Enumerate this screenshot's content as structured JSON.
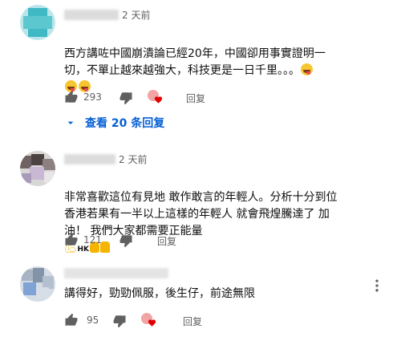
{
  "comments": [
    {
      "time": "2 天前",
      "text": "西方講咗中國崩潰論已經20年，中國卻用事實證明一\n切，不單止越來越強大，科技更是一日千里。。。",
      "likes": "293",
      "reply_label": "回复",
      "view_replies": "查看 20 条回复"
    },
    {
      "time": "2 天前",
      "text": "非常喜歡這位有見地 敢作敢言的年輕人。分析十分到位\n香港若果有一半以上這樣的年輕人 就會飛煌騰達了 加\n油！ 我們大家都需要正能量",
      "emoji_text": "HK",
      "likes": "121",
      "reply_label": "回复"
    },
    {
      "text": "講得好，勁勁佩服，後生仔，前途無限",
      "likes": "95",
      "reply_label": "回复"
    }
  ],
  "colors": {
    "link": "#065fd4",
    "secondary": "#606060",
    "heart": "#e00000"
  },
  "icons": [
    "thumb-up-icon",
    "thumb-down-icon",
    "creator-heart-icon",
    "chevron-down-icon",
    "kebab-menu-icon",
    "grin-emoji-icon",
    "flexed-biceps-emoji-icon",
    "thumbs-up-emoji-icon"
  ]
}
